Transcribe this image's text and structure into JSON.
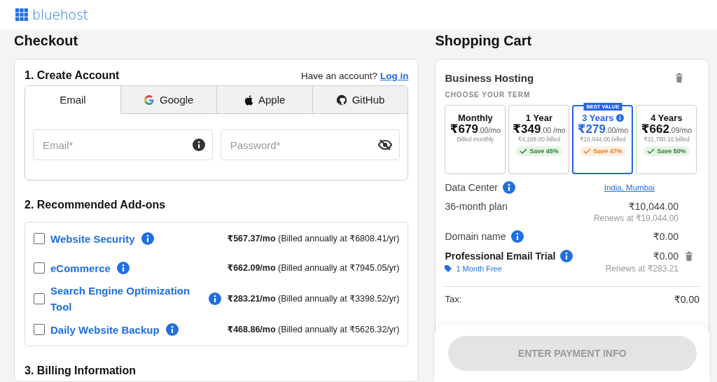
{
  "header": {
    "brand": "bluehost"
  },
  "checkout": {
    "title": "Checkout",
    "account": {
      "title": "1. Create Account",
      "prompt": "Have an account?",
      "link": "Log in",
      "tabs": [
        {
          "label": "Email",
          "kind": "email",
          "selected": true
        },
        {
          "label": "Google",
          "kind": "google",
          "selected": false
        },
        {
          "label": "Apple",
          "kind": "apple",
          "selected": false
        },
        {
          "label": "GitHub",
          "kind": "github",
          "selected": false
        }
      ],
      "fields": [
        {
          "placeholder": "Email*",
          "kind": "info"
        },
        {
          "placeholder": "Password*",
          "kind": "reveal"
        }
      ]
    },
    "addons": {
      "title": "2. Recommended Add-ons",
      "items": [
        {
          "name": "Website Security",
          "info": true,
          "checked": false,
          "price": "**₹567.37/mo** (Billed annually at ₹6808.41/yr)"
        },
        {
          "name": "eCommerce",
          "info": true,
          "checked": false,
          "price": "**₹662.09/mo** (Billed annually at ₹7945.05/yr)"
        },
        {
          "name": "Search Engine Optimization Tool",
          "info": true,
          "checked": false,
          "price": "**₹283.21/mo** (Billed annually at ₹3398.52/yr)"
        },
        {
          "name": "Daily Website Backup",
          "info": true,
          "checked": false,
          "price": "**₹468.86/mo** (Billed annually at ₹5626.32/yr)"
        }
      ]
    },
    "billing": {
      "title": "3. Billing Information"
    }
  },
  "cart": {
    "title": "Shopping Cart",
    "product": "Business Hosting",
    "term_label": "CHOOSE YOUR TERM",
    "terms": [
      {
        "name": "Monthly",
        "price": "**₹679**.00/mo",
        "billed": "Billed monthly",
        "selected": false
      },
      {
        "name": "1 Year",
        "price": "**₹349**.00 /mo",
        "billed": "₹4,188.00 billed",
        "save": "Save 45%",
        "selected": false
      },
      {
        "name": "3 Years",
        "badge": "BEST VALUE",
        "info": true,
        "price": "**₹279**.00/mo",
        "billed": "₹10,044.00 billed",
        "save": "Save 47%",
        "selected": true
      },
      {
        "name": "4 Years",
        "price": "**₹662**.09/mo",
        "billed": "₹31,780.16 billed",
        "save": "Save 50%",
        "selected": false
      }
    ],
    "lines": [
      {
        "label": "Data Center",
        "info": true,
        "link": "India, Mumbai"
      },
      {
        "label": "36-month plan",
        "amount": "₹10,044.00",
        "note": "Renews at ₹19,044.00"
      },
      {
        "label": "Domain name",
        "info": true,
        "amount": "₹0.00"
      },
      {
        "label": "Professional Email Trial",
        "bold": true,
        "info": true,
        "amount": "₹0.00",
        "removable": true,
        "tag": "1 Month Free",
        "note": "Renews at ₹283.21"
      }
    ],
    "tax": {
      "label": "Tax:",
      "amount": "₹0.00"
    },
    "button": {
      "label": "ENTER PAYMENT INFO",
      "disabled": true
    }
  }
}
